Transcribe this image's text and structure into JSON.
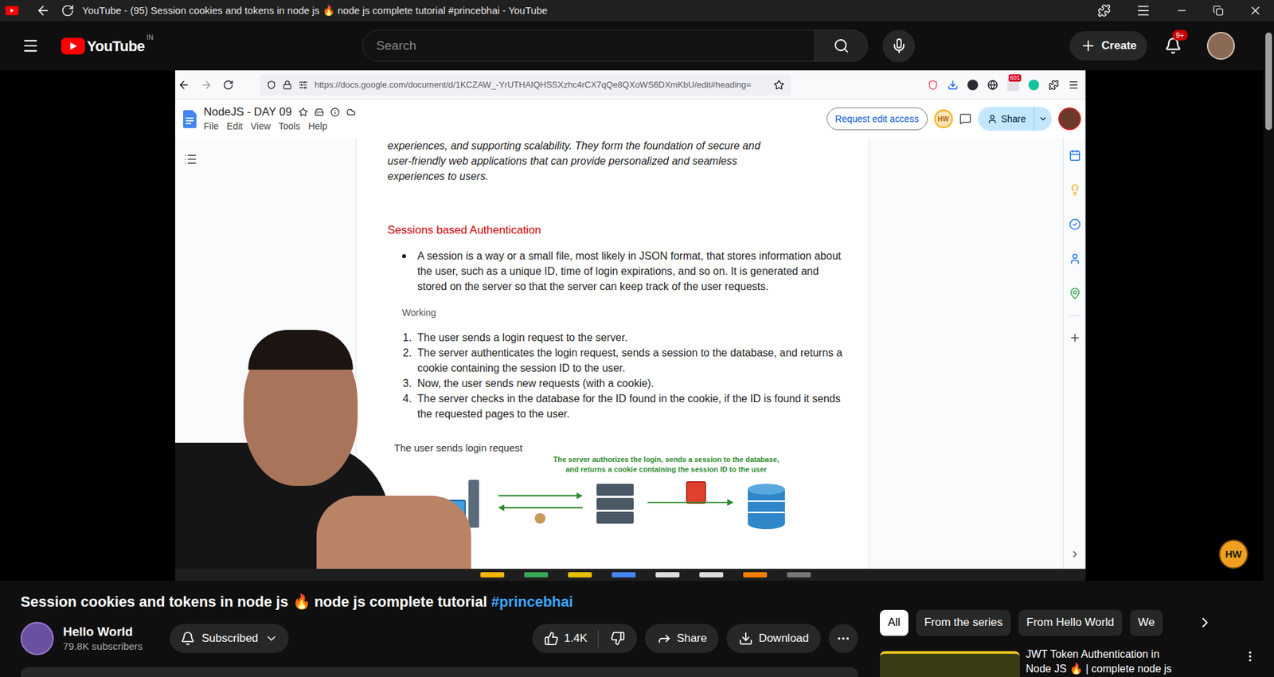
{
  "browser": {
    "title": "YouTube - (95) Session cookies and tokens in node js 🔥 node js complete tutorial #princebhai - YouTube"
  },
  "header": {
    "logo": "YouTube",
    "region": "IN",
    "search": {
      "placeholder": "Search"
    },
    "create": "Create",
    "notifications": "9+"
  },
  "video": {
    "browser": {
      "url": "https://docs.google.com/document/d/1KCZAW_-YrUTHAIQHSSXzhc4rCX7qQe8QXoWS6DXmKbU/edit#heading=",
      "extension_badge": "601"
    },
    "doc": {
      "title": "NodeJS - DAY 09",
      "menu": [
        "File",
        "Edit",
        "View",
        "Tools",
        "Help"
      ],
      "request_access": "Request edit access",
      "collaborator": "HW",
      "share": "Share",
      "intro_lines": [
        "experiences, and supporting scalability. They form the foundation of secure and",
        "user-friendly web applications that can provide personalized and seamless",
        "experiences to users."
      ],
      "heading": "Sessions based Authentication",
      "bullet": "A session is a way or a small file, most likely in JSON format, that stores information about the user, such as a unique ID, time of login expirations, and so on. It is generated and stored on the server so that the server can keep track of the user requests.",
      "working": "Working",
      "steps": [
        {
          "number": "1.",
          "text": "The user sends a login request to the server."
        },
        {
          "number": "2.",
          "text": "The server authenticates the login request, sends a session to the database, and returns a cookie containing the session ID to the user."
        },
        {
          "number": "3.",
          "text": "Now, the user sends new requests (with a cookie)."
        },
        {
          "number": "4.",
          "text": "The server checks in the database for the ID found in the cookie, if the ID is found it sends the requested pages to the user."
        }
      ],
      "diagram": {
        "caption": "The user sends login request",
        "label_lines": [
          "The server authorizes the login, sends a session to the database,",
          "and returns a cookie containing the session ID to the user"
        ]
      }
    },
    "watermark": "HW"
  },
  "title": "Session cookies and tokens in node js 🔥 node js complete tutorial",
  "hashtag": "#princebhai",
  "channel": {
    "name": "Hello World",
    "subscribers": "79.8K subscribers",
    "subscribe_button": "Subscribed",
    "subscribed": true
  },
  "actions": {
    "likes": "1.4K",
    "share": "Share",
    "download": "Download"
  },
  "chips": [
    {
      "label": "All",
      "selected": true
    },
    {
      "label": "From the series",
      "selected": false
    },
    {
      "label": "From Hello World",
      "selected": false
    },
    {
      "label": "We",
      "selected": false
    }
  ],
  "recommendations": [
    {
      "title_lines": [
        "JWT Token Authentication in",
        "Node JS 🔥 | complete node js"
      ]
    }
  ]
}
